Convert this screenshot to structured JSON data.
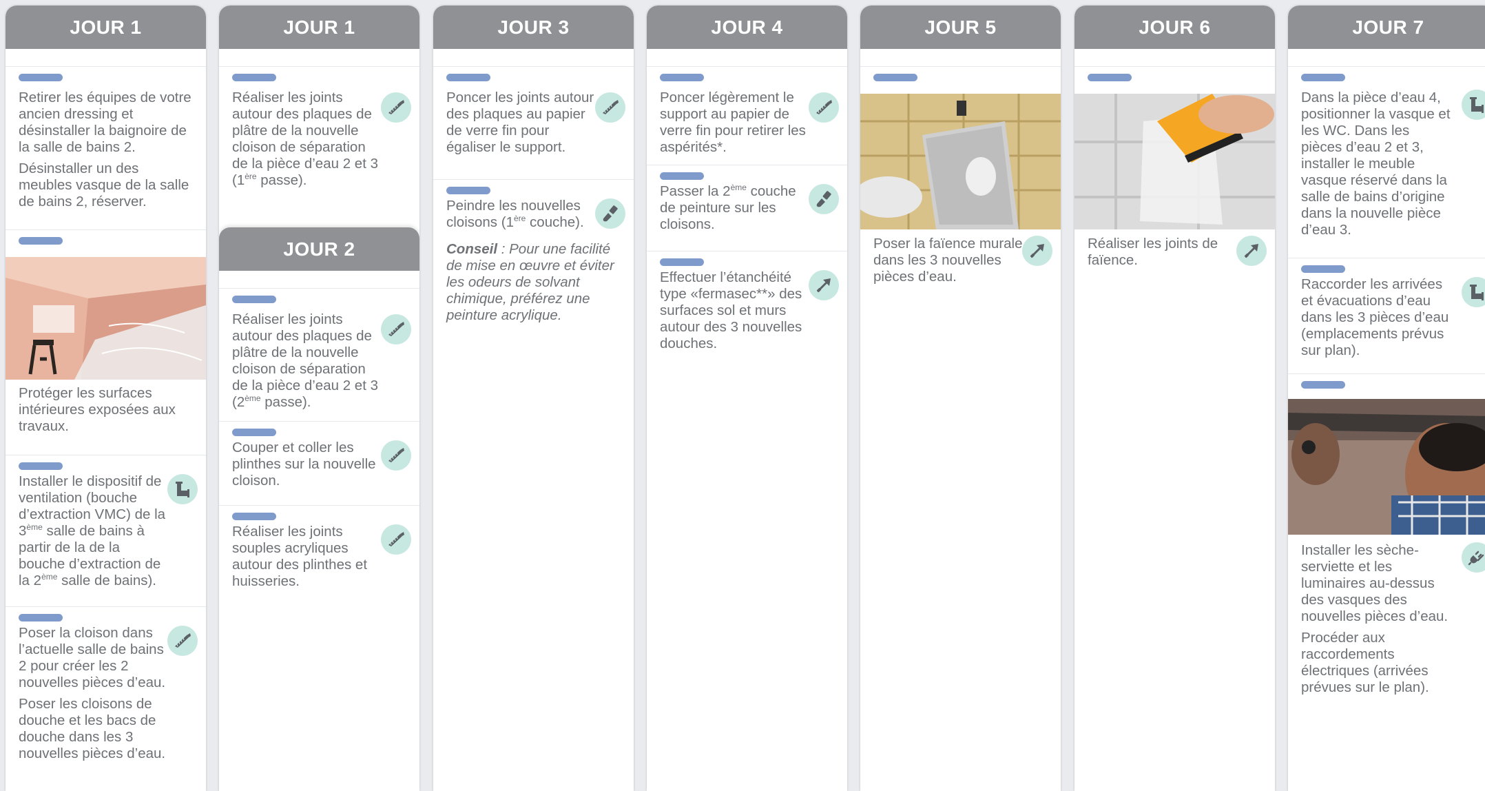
{
  "columns": [
    {
      "title": "JOUR 1",
      "tasks": [
        {
          "p1": "Retirer les équipes de votre ancien dressing et désinstaller la baignoire de la salle de bains 2.",
          "p2": "Désinstaller un des meubles vasque de la salle de bains 2, réserver."
        },
        {
          "photo": "protected-room-photo",
          "p1": "Protéger les surfaces intérieures exposées aux travaux."
        },
        {
          "icon": "plumbing-pipe-icon",
          "p1a": "Installer le dispositif de ventilation (bouche d’extraction VMC) de la 3",
          "sup": "ème",
          "p1b": " salle de bains à partir de la de la bouche d’extraction de la 2",
          "sup2": "ème",
          "p1c": " salle de bains)."
        },
        {
          "icon": "saw-icon",
          "p1": "Poser la cloison dans l’actuelle salle de bains 2 pour créer les 2 nouvelles pièces d’eau.",
          "p2": "Poser les cloisons de douche et les bacs de douche dans les 3 nouvelles pièces d’eau."
        }
      ]
    },
    {
      "title": "JOUR 1",
      "tasks": [
        {
          "icon": "saw-icon",
          "p1a": "Réaliser les joints autour des plaques de plâtre de la nouvelle cloison de séparation de la pièce d’eau 2 et 3 (1",
          "sup": "ère",
          "p1b": " passe)."
        }
      ],
      "sub_title": "JOUR 2",
      "sub_tasks": [
        {
          "icon": "saw-icon",
          "p1a": "Réaliser les joints autour des plaques de plâtre de la nouvelle cloison de séparation de la pièce d’eau 2 et 3 (2",
          "sup": "ème",
          "p1b": " passe)."
        },
        {
          "icon": "saw-icon",
          "p1": "Couper et coller les plinthes sur la nouvelle cloison."
        },
        {
          "icon": "saw-icon",
          "p1": "Réaliser les joints souples acryliques autour des plinthes et huisseries."
        }
      ]
    },
    {
      "title": "JOUR 3",
      "tasks": [
        {
          "icon": "saw-icon",
          "p1": "Poncer les joints autour des plaques au papier de verre fin pour égaliser le support."
        },
        {
          "icon": "paint-brush-icon",
          "p1a": "Peindre les nouvelles cloisons (1",
          "sup": "ère",
          "p1b": " couche).",
          "tip_label": "Conseil",
          "tip_text": " : Pour une facilité de mise en œuvre et éviter les odeurs de solvant chimique, préférez une peinture acrylique."
        }
      ]
    },
    {
      "title": "JOUR 4",
      "tasks": [
        {
          "icon": "saw-icon",
          "p1": "Poncer légèrement le support au papier de verre fin pour retirer les aspérités*."
        },
        {
          "icon": "paint-brush-icon",
          "p1a": "Passer la 2",
          "sup": "ème",
          "p1b": " couche de peinture sur les cloisons."
        },
        {
          "icon": "trowel-icon",
          "p1": "Effectuer l’étanchéité type «fermasec**» des surfaces sol et murs autour des 3 nouvelles douches."
        }
      ]
    },
    {
      "title": "JOUR 5",
      "tasks": [
        {
          "photo": "tiling-wall-photo",
          "icon": "trowel-icon",
          "p1": "Poser la faïence murale dans les 3 nouvelles pièces d’eau."
        }
      ]
    },
    {
      "title": "JOUR 6",
      "tasks": [
        {
          "photo": "grout-joints-photo",
          "icon": "trowel-icon",
          "p1": "Réaliser les joints de faïence."
        }
      ]
    },
    {
      "title": "JOUR 7",
      "tasks": [
        {
          "icon": "plumbing-pipe-icon",
          "p1": "Dans la pièce d’eau 4, positionner la vasque et les WC. Dans les pièces d’eau 2 et 3, installer le meuble vasque réservé dans la salle de bains d’origine dans la nouvelle pièce d’eau 3."
        },
        {
          "icon": "plumbing-pipe-icon",
          "p1": "Raccorder les arrivées et évacuations d’eau dans les 3 pièces d’eau (emplacements prévus sur plan)."
        },
        {
          "photo": "electrician-photo",
          "icon": "electric-plug-icon",
          "p1": "Installer les sèche-serviette et les luminaires au-dessus des vasques des nouvelles pièces d’eau.",
          "p2": "Procéder aux raccordements électriques (arrivées prévues sur le plan)."
        }
      ]
    }
  ],
  "colors": {
    "header": "#8f9194",
    "accent_bar": "#7f9bcc",
    "icon_bg": "#c7e8e0",
    "icon_fg": "#5b6066",
    "text": "#6e7176",
    "background": "#e9ebef"
  }
}
